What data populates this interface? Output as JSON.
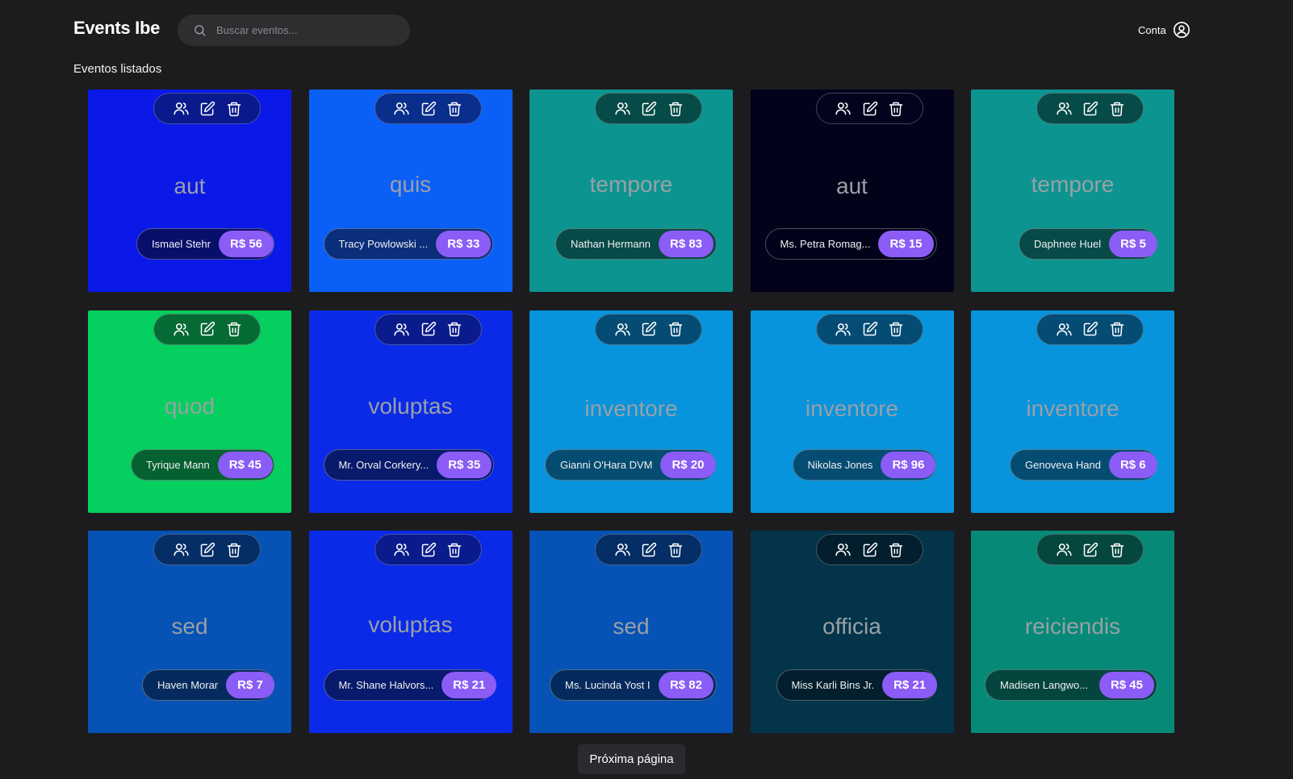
{
  "header": {
    "logo": "Events Ibe",
    "search_placeholder": "Buscar eventos...",
    "account_label": "Conta"
  },
  "section_title": "Eventos listados",
  "events": [
    {
      "title": "aut",
      "host": "Ismael Stehr",
      "price": "R$ 56",
      "color": "#0a18e8",
      "pill_bg": "#080f6a",
      "actions_bg": "#0a1a8c"
    },
    {
      "title": "quis",
      "host": "Tracy Powlowski ...",
      "price": "R$ 33",
      "color": "#0a5ff7",
      "pill_bg": "#0a2e7a",
      "actions_bg": "#0a2e8c"
    },
    {
      "title": "tempore",
      "host": "Nathan Hermann",
      "price": "R$ 83",
      "color": "#0c9590",
      "pill_bg": "#074a48",
      "actions_bg": "#064b47"
    },
    {
      "title": "aut",
      "host": "Ms. Petra Romag...",
      "price": "R$ 15",
      "color": "#02021a",
      "pill_bg": "#02021a",
      "actions_bg": "#03031e"
    },
    {
      "title": "tempore",
      "host": "Daphnee Huel",
      "price": "R$ 5",
      "color": "#0c9590",
      "pill_bg": "#074a48",
      "actions_bg": "#064b47"
    },
    {
      "title": "quod",
      "host": "Tyrique Mann",
      "price": "R$ 45",
      "color": "#05cf5f",
      "pill_bg": "#056130",
      "actions_bg": "#066a35"
    },
    {
      "title": "voluptas",
      "host": "Mr. Orval Corkery...",
      "price": "R$ 35",
      "color": "#0a2ae8",
      "pill_bg": "#081a6c",
      "actions_bg": "#0a1c8c"
    },
    {
      "title": "inventore",
      "host": "Gianni O'Hara DVM",
      "price": "R$ 20",
      "color": "#0794dc",
      "pill_bg": "#054c72",
      "actions_bg": "#054c75"
    },
    {
      "title": "inventore",
      "host": "Nikolas Jones",
      "price": "R$ 96",
      "color": "#0794dc",
      "pill_bg": "#054c72",
      "actions_bg": "#054c75"
    },
    {
      "title": "inventore",
      "host": "Genoveva Hand",
      "price": "R$ 6",
      "color": "#0794dc",
      "pill_bg": "#054c72",
      "actions_bg": "#054c75"
    },
    {
      "title": "sed",
      "host": "Haven Morar",
      "price": "R$ 7",
      "color": "#0652b5",
      "pill_bg": "#052b5e",
      "actions_bg": "#052d66"
    },
    {
      "title": "voluptas",
      "host": "Mr. Shane Halvors...",
      "price": "R$ 21",
      "color": "#0a2ae8",
      "pill_bg": "#081a6c",
      "actions_bg": "#0a1c8c"
    },
    {
      "title": "sed",
      "host": "Ms. Lucinda Yost I",
      "price": "R$ 82",
      "color": "#0652b5",
      "pill_bg": "#052b5e",
      "actions_bg": "#052d66"
    },
    {
      "title": "officia",
      "host": "Miss Karli Bins Jr.",
      "price": "R$ 21",
      "color": "#03344a",
      "pill_bg": "#031e2c",
      "actions_bg": "#031e2c"
    },
    {
      "title": "reiciendis",
      "host": "Madisen Langwo...",
      "price": "R$ 45",
      "color": "#068a77",
      "pill_bg": "#04463e",
      "actions_bg": "#05473e"
    }
  ],
  "pagination": {
    "next_label": "Próxima página"
  },
  "colors": {
    "background": "#1c1c1e",
    "price_badge": "#8b5cf6",
    "search_bg": "#2e2e31"
  }
}
